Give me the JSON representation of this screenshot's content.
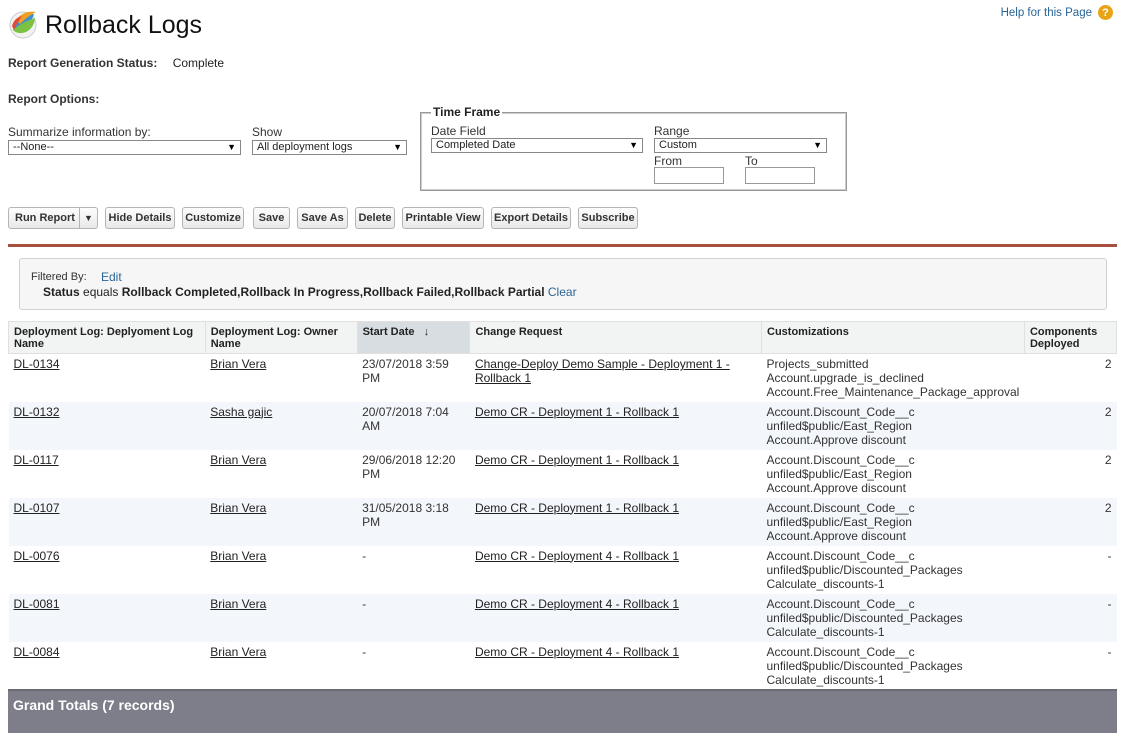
{
  "page": {
    "title": "Rollback Logs",
    "help_label": "Help for this Page",
    "help_icon": "?"
  },
  "status": {
    "label": "Report Generation Status:",
    "value": "Complete"
  },
  "options": {
    "label": "Report Options:",
    "summarize_label": "Summarize information by:",
    "summarize_value": "--None--",
    "show_label": "Show",
    "show_value": "All deployment logs"
  },
  "timeframe": {
    "legend": "Time Frame",
    "date_field_label": "Date Field",
    "date_field_value": "Completed Date",
    "range_label": "Range",
    "range_value": "Custom",
    "from_label": "From",
    "to_label": "To",
    "from_value": "",
    "to_value": ""
  },
  "toolbar": {
    "run_report": "Run Report",
    "hide_details": "Hide Details",
    "customize": "Customize",
    "save": "Save",
    "save_as": "Save As",
    "delete": "Delete",
    "printable_view": "Printable View",
    "export_details": "Export Details",
    "subscribe": "Subscribe"
  },
  "filter": {
    "label": "Filtered By:",
    "edit": "Edit",
    "field": "Status",
    "operator": "equals",
    "values": "Rollback Completed,Rollback In Progress,Rollback Failed,Rollback Partial",
    "clear": "Clear"
  },
  "table": {
    "headers": [
      "Deployment Log: Deplyoment Log Name",
      "Deployment Log: Owner Name",
      "Start Date",
      "Change Request",
      "Customizations",
      "Components Deployed"
    ],
    "sort_indicator": "↓",
    "rows": [
      {
        "name": "DL-0134",
        "owner": "Brian Vera",
        "start": "23/07/2018 3:59 PM",
        "change_request": "Change-Deploy Demo Sample - Deployment 1 - Rollback 1",
        "customizations": [
          "Projects_submitted",
          "Account.upgrade_is_declined",
          "Account.Free_Maintenance_Package_approval"
        ],
        "components": "2"
      },
      {
        "name": "DL-0132",
        "owner": "Sasha gajic",
        "start": "20/07/2018 7:04 AM",
        "change_request": "Demo CR - Deployment 1 - Rollback 1",
        "customizations": [
          "Account.Discount_Code__c",
          "unfiled$public/East_Region",
          "Account.Approve discount"
        ],
        "components": "2"
      },
      {
        "name": "DL-0117",
        "owner": "Brian Vera",
        "start": "29/06/2018 12:20 PM",
        "change_request": "Demo CR - Deployment 1 - Rollback 1",
        "customizations": [
          "Account.Discount_Code__c",
          "unfiled$public/East_Region",
          "Account.Approve discount"
        ],
        "components": "2"
      },
      {
        "name": "DL-0107",
        "owner": "Brian Vera",
        "start": "31/05/2018 3:18 PM",
        "change_request": "Demo CR - Deployment 1 - Rollback 1",
        "customizations": [
          "Account.Discount_Code__c",
          "unfiled$public/East_Region",
          "Account.Approve discount"
        ],
        "components": "2"
      },
      {
        "name": "DL-0076",
        "owner": "Brian Vera",
        "start": "-",
        "change_request": "Demo CR - Deployment 4 - Rollback 1",
        "customizations": [
          "Account.Discount_Code__c",
          "unfiled$public/Discounted_Packages",
          "Calculate_discounts-1"
        ],
        "components": "-"
      },
      {
        "name": "DL-0081",
        "owner": "Brian Vera",
        "start": "-",
        "change_request": "Demo CR - Deployment 4 - Rollback 1",
        "customizations": [
          "Account.Discount_Code__c",
          "unfiled$public/Discounted_Packages",
          "Calculate_discounts-1"
        ],
        "components": "-"
      },
      {
        "name": "DL-0084",
        "owner": "Brian Vera",
        "start": "-",
        "change_request": "Demo CR - Deployment 4 - Rollback 1",
        "customizations": [
          "Account.Discount_Code__c",
          "unfiled$public/Discounted_Packages",
          "Calculate_discounts-1"
        ],
        "components": "-"
      }
    ]
  },
  "grand_totals": "Grand Totals (7 records)",
  "colors": {
    "accent_bar": "#a8503c",
    "link": "#2a6496",
    "grand_totals_bg": "#7d7e89"
  }
}
